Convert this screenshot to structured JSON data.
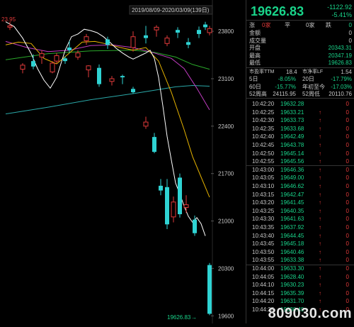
{
  "chart": {
    "date_range": "2019/08/09-2020/03/09(139日)",
    "top_left_value": "23.95",
    "y_ticks": [
      "23800",
      "23100",
      "22400",
      "21700",
      "21000",
      "20300",
      "19600"
    ],
    "last_price_label": "19626.83",
    "last_price_arrow": "→",
    "candles": [
      {
        "o": 23880,
        "h": 23940,
        "l": 23820,
        "c": 23860,
        "color": "red"
      },
      {
        "o": 23240,
        "h": 23330,
        "l": 23180,
        "c": 23300,
        "color": "red"
      },
      {
        "o": 23360,
        "h": 23460,
        "l": 23240,
        "c": 23280,
        "color": "cyan"
      },
      {
        "o": 23420,
        "h": 23520,
        "l": 23320,
        "c": 23470,
        "color": "red"
      },
      {
        "o": 23200,
        "h": 23360,
        "l": 23180,
        "c": 23330,
        "color": "red"
      },
      {
        "o": 23400,
        "h": 23430,
        "l": 23320,
        "c": 23360,
        "color": "cyan"
      },
      {
        "o": 23420,
        "h": 23520,
        "l": 23380,
        "c": 23480,
        "color": "red"
      },
      {
        "o": 23230,
        "h": 23300,
        "l": 23120,
        "c": 23290,
        "color": "red"
      },
      {
        "o": 23260,
        "h": 23310,
        "l": 22980,
        "c": 23020,
        "color": "cyan"
      },
      {
        "o": 23100,
        "h": 23140,
        "l": 23000,
        "c": 23060,
        "color": "red"
      },
      {
        "o": 23120,
        "h": 23160,
        "l": 23020,
        "c": 23140,
        "color": "cyan"
      },
      {
        "o": 23560,
        "h": 23800,
        "l": 23500,
        "c": 23720,
        "color": "red"
      },
      {
        "o": 23700,
        "h": 23880,
        "l": 23620,
        "c": 23740,
        "color": "cyan"
      },
      {
        "o": 23820,
        "h": 23890,
        "l": 23720,
        "c": 23860,
        "color": "red"
      },
      {
        "o": 23620,
        "h": 23740,
        "l": 23580,
        "c": 23700,
        "color": "red"
      },
      {
        "o": 23780,
        "h": 23860,
        "l": 23700,
        "c": 23820,
        "color": "cyan"
      },
      {
        "o": 23640,
        "h": 23700,
        "l": 23550,
        "c": 23600,
        "color": "cyan"
      },
      {
        "o": 23820,
        "h": 23870,
        "l": 23700,
        "c": 23760,
        "color": "cyan"
      },
      {
        "o": 23900,
        "h": 23940,
        "l": 23820,
        "c": 23860,
        "color": "cyan"
      },
      {
        "o": 23780,
        "h": 23880,
        "l": 23740,
        "c": 23840,
        "color": "red"
      },
      {
        "o": 23360,
        "h": 23480,
        "l": 23320,
        "c": 23440,
        "color": "red"
      },
      {
        "o": 23560,
        "h": 23660,
        "l": 23480,
        "c": 23520,
        "color": "cyan"
      },
      {
        "o": 23660,
        "h": 23760,
        "l": 23600,
        "c": 23720,
        "color": "red"
      },
      {
        "o": 23600,
        "h": 23720,
        "l": 23540,
        "c": 23680,
        "color": "cyan"
      },
      {
        "o": 22900,
        "h": 22980,
        "l": 22880,
        "c": 22950,
        "color": "cyan"
      },
      {
        "o": 22460,
        "h": 22540,
        "l": 22360,
        "c": 22400,
        "color": "red"
      },
      {
        "o": 22240,
        "h": 22300,
        "l": 22000,
        "c": 22020,
        "color": "cyan"
      },
      {
        "o": 21450,
        "h": 21620,
        "l": 21380,
        "c": 21520,
        "color": "cyan"
      },
      {
        "o": 21500,
        "h": 21620,
        "l": 20880,
        "c": 20950,
        "color": "cyan"
      },
      {
        "o": 21280,
        "h": 21360,
        "l": 20980,
        "c": 21060,
        "color": "red"
      },
      {
        "o": 21640,
        "h": 21700,
        "l": 21050,
        "c": 21100,
        "color": "cyan"
      },
      {
        "o": 21240,
        "h": 21380,
        "l": 21120,
        "c": 21200,
        "color": "red"
      },
      {
        "o": 21020,
        "h": 21080,
        "l": 20780,
        "c": 20820,
        "color": "cyan"
      },
      {
        "o": 20350,
        "h": 20380,
        "l": 19610,
        "c": 19630,
        "color": "cyan"
      }
    ],
    "ma5": [
      [
        0,
        23940
      ],
      [
        4,
        23870
      ],
      [
        8,
        23700
      ],
      [
        12,
        23470
      ],
      [
        15,
        23250
      ],
      [
        18,
        23080
      ],
      [
        21,
        22960
      ],
      [
        24,
        23120
      ],
      [
        28,
        23520
      ],
      [
        31,
        23720
      ],
      [
        34,
        23760
      ],
      [
        37,
        23830
      ],
      [
        40,
        23810
      ],
      [
        43,
        23780
      ],
      [
        46,
        23720
      ],
      [
        49,
        23640
      ],
      [
        52,
        23550
      ],
      [
        55,
        23480
      ],
      [
        58,
        23420
      ],
      [
        60,
        23390
      ],
      [
        62,
        23420
      ],
      [
        64,
        23450
      ],
      [
        66,
        23480
      ],
      [
        68,
        23520
      ],
      [
        70,
        23400
      ],
      [
        72,
        23120
      ],
      [
        74,
        22700
      ],
      [
        76,
        22250
      ],
      [
        78,
        21900
      ],
      [
        80,
        21560
      ],
      [
        82,
        21400
      ],
      [
        84,
        21220
      ],
      [
        86,
        21070
      ],
      [
        88,
        20980
      ],
      [
        90,
        21050
      ],
      [
        92,
        20960
      ],
      [
        94,
        20780
      ]
    ],
    "ma10": [
      [
        0,
        23600
      ],
      [
        6,
        23640
      ],
      [
        12,
        23620
      ],
      [
        18,
        23400
      ],
      [
        24,
        23320
      ],
      [
        30,
        23480
      ],
      [
        36,
        23640
      ],
      [
        42,
        23650
      ],
      [
        48,
        23610
      ],
      [
        54,
        23560
      ],
      [
        60,
        23520
      ],
      [
        66,
        23560
      ],
      [
        72,
        23360
      ],
      [
        78,
        22900
      ],
      [
        84,
        22350
      ],
      [
        88,
        21950
      ],
      [
        92,
        21650
      ],
      [
        96,
        21350
      ]
    ],
    "ma20": [
      [
        0,
        23650
      ],
      [
        10,
        23560
      ],
      [
        20,
        23500
      ],
      [
        30,
        23520
      ],
      [
        40,
        23590
      ],
      [
        50,
        23600
      ],
      [
        60,
        23560
      ],
      [
        70,
        23480
      ],
      [
        78,
        23400
      ],
      [
        84,
        23250
      ],
      [
        90,
        22960
      ],
      [
        96,
        22640
      ]
    ],
    "ma60": [
      [
        0,
        23380
      ],
      [
        20,
        23470
      ],
      [
        40,
        23510
      ],
      [
        60,
        23520
      ],
      [
        70,
        23490
      ],
      [
        80,
        23420
      ],
      [
        88,
        23310
      ],
      [
        96,
        23240
      ]
    ],
    "ma120": [
      [
        0,
        22580
      ],
      [
        20,
        22680
      ],
      [
        40,
        22790
      ],
      [
        60,
        22880
      ],
      [
        70,
        22930
      ],
      [
        80,
        22980
      ],
      [
        88,
        23000
      ],
      [
        96,
        22990
      ]
    ]
  },
  "panel": {
    "price": "19626.83",
    "change": "-1122.92",
    "pct": "-5.41%",
    "rows_top": [
      {
        "k": "涨",
        "v": "0家",
        "k2": "平",
        "v2": "0家",
        "k3": "跌",
        "v3": "0"
      },
      {
        "k": "金额",
        "v": "0"
      },
      {
        "k": "成交量",
        "v": "0"
      },
      {
        "k": "开盘",
        "v": "20343.31"
      },
      {
        "k": "最高",
        "v": "20347.19"
      },
      {
        "k": "最低",
        "v": "19626.83"
      }
    ],
    "pe": {
      "k": "市盈率TTM",
      "v": "18.4",
      "k2": "市净率LF",
      "v2": "1.54"
    },
    "stats": [
      {
        "k": "5日",
        "v": "-8.05%",
        "k2": "20日",
        "v2": "-17.79%"
      },
      {
        "k": "60日",
        "v": "-15.77%",
        "k2": "年初至今",
        "v2": "-17.03%"
      },
      {
        "k": "52周高",
        "v": "24115.95",
        "k2": "52周低",
        "v2": "20110.76"
      }
    ],
    "ticks": [
      {
        "t": "10:42:20",
        "p": "19632.28",
        "a": "",
        "v": "0"
      },
      {
        "t": "10:42:25",
        "p": "19633.21",
        "a": "↑",
        "v": "0"
      },
      {
        "t": "10:42:30",
        "p": "19633.73",
        "a": "↑",
        "v": "0"
      },
      {
        "t": "10:42:35",
        "p": "19633.68",
        "a": "↑",
        "v": "0"
      },
      {
        "t": "10:42:40",
        "p": "19642.49",
        "a": "↑",
        "v": "0"
      },
      {
        "t": "10:42:45",
        "p": "19643.78",
        "a": "↑",
        "v": "0"
      },
      {
        "t": "10:42:50",
        "p": "19645.14",
        "a": "↑",
        "v": "0"
      },
      {
        "t": "10:42:55",
        "p": "19645.56",
        "a": "↑",
        "v": "0"
      },
      {
        "t": "10:43:00",
        "p": "19646.36",
        "a": "↑",
        "v": "0"
      },
      {
        "t": "10:43:05",
        "p": "19649.00",
        "a": "↑",
        "v": "0"
      },
      {
        "t": "10:43:10",
        "p": "19646.62",
        "a": "↑",
        "v": "0"
      },
      {
        "t": "10:43:15",
        "p": "19642.47",
        "a": "↑",
        "v": "0"
      },
      {
        "t": "10:43:20",
        "p": "19641.45",
        "a": "↑",
        "v": "0"
      },
      {
        "t": "10:43:25",
        "p": "19640.35",
        "a": "↑",
        "v": "0"
      },
      {
        "t": "10:43:30",
        "p": "19641.63",
        "a": "↑",
        "v": "0"
      },
      {
        "t": "10:43:35",
        "p": "19637.92",
        "a": "↑",
        "v": "0"
      },
      {
        "t": "10:43:40",
        "p": "19644.45",
        "a": "↑",
        "v": "0"
      },
      {
        "t": "10:43:45",
        "p": "19645.18",
        "a": "↑",
        "v": "0"
      },
      {
        "t": "10:43:50",
        "p": "19640.46",
        "a": "↑",
        "v": "0"
      },
      {
        "t": "10:43:55",
        "p": "19633.38",
        "a": "↑",
        "v": "0"
      },
      {
        "t": "10:44:00",
        "p": "19633.30",
        "a": "↑",
        "v": "0"
      },
      {
        "t": "10:44:05",
        "p": "19628.40",
        "a": "↑",
        "v": "0"
      },
      {
        "t": "10:44:10",
        "p": "19630.23",
        "a": "↑",
        "v": "0"
      },
      {
        "t": "10:44:15",
        "p": "19635.39",
        "a": "↑",
        "v": "0"
      },
      {
        "t": "10:44:20",
        "p": "19631.70",
        "a": "↑",
        "v": "0"
      },
      {
        "t": "10:44:25",
        "p": "19630.49",
        "a": "↑",
        "v": "0"
      }
    ]
  },
  "watermark": "809030.com",
  "colors": {
    "up": "#e03a3a",
    "down": "#2fd3d3",
    "green": "#19d48a",
    "ma5": "#ffffff",
    "ma10": "#e6b300",
    "ma20": "#c03cc0",
    "ma60": "#2aa72a",
    "ma120": "#2aa7a7"
  }
}
